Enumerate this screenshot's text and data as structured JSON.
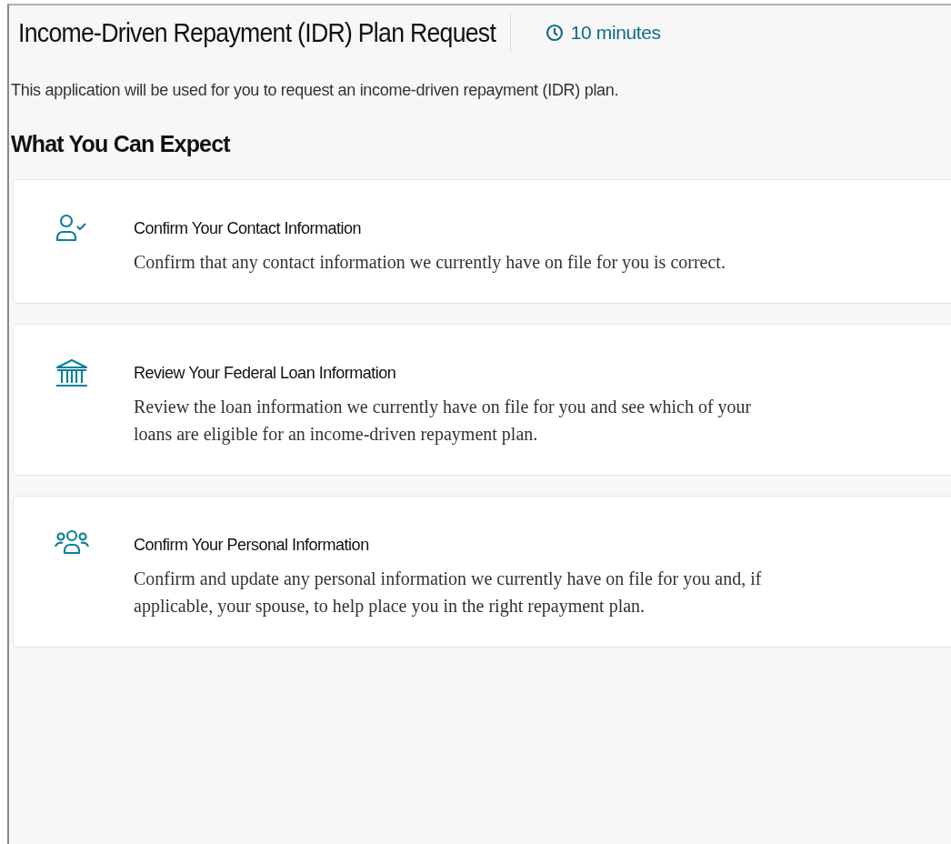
{
  "header": {
    "title": "Income-Driven Repayment (IDR) Plan Request",
    "duration": "10 minutes"
  },
  "intro": "This application will be used for you to request an income-driven repayment (IDR) plan.",
  "section_title": "What You Can Expect",
  "steps": [
    {
      "kind": "person-check",
      "title": "Confirm Your Contact Information",
      "description": "Confirm that any contact information we currently have on file for you is correct."
    },
    {
      "kind": "bank",
      "title": "Review Your Federal Loan Information",
      "description": "Review the loan information we currently have on file for you and see which of your loans are eligible for an income-driven repayment plan."
    },
    {
      "kind": "group",
      "title": "Confirm Your Personal Information",
      "description": "Confirm and update any personal information we currently have on file for you and, if applicable, your spouse, to help place you in the right repayment plan."
    }
  ]
}
